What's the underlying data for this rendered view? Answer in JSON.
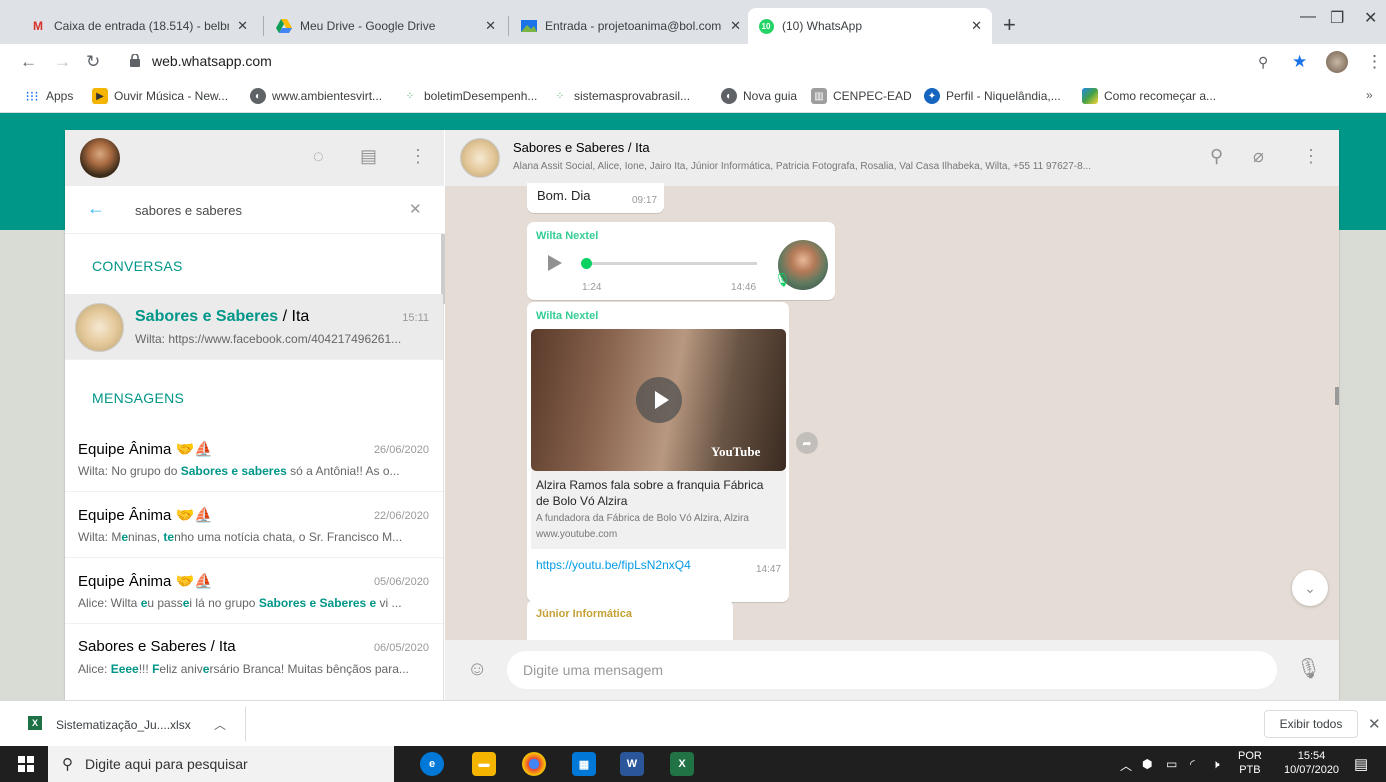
{
  "browser": {
    "tabs": [
      {
        "label": "Caixa de entrada (18.514) - belbr",
        "icon": "gmail-icon"
      },
      {
        "label": "Meu Drive - Google Drive",
        "icon": "drive-icon"
      },
      {
        "label": "Entrada - projetoanima@bol.com",
        "icon": "bol-icon"
      },
      {
        "label": "(10) WhatsApp",
        "icon": "whatsapp-icon",
        "active": true
      }
    ],
    "url": "web.whatsapp.com",
    "bookmarks": [
      {
        "label": "Apps"
      },
      {
        "label": "Ouvir Música - New..."
      },
      {
        "label": "www.ambientesvirt..."
      },
      {
        "label": "boletimDesempenh..."
      },
      {
        "label": "sistemasprovabrasil..."
      },
      {
        "label": "Nova guia"
      },
      {
        "label": "CENPEC-EAD"
      },
      {
        "label": "Perfil - Niquelândia,..."
      },
      {
        "label": "Como recomeçar a..."
      }
    ],
    "bookmarks_more": "»"
  },
  "sidebar": {
    "search_value": "sabores e saberes",
    "section_conversations": "CONVERSAS",
    "section_messages": "MENSAGENS",
    "conversation": {
      "title_bold": "Sabores e Saberes",
      "title_rest": " / Ita",
      "time": "15:11",
      "preview": "Wilta: https://www.facebook.com/404217496261..."
    },
    "messages": [
      {
        "title": "Equipe Ânima",
        "time": "26/06/2020",
        "p1": "Wilta: No grupo do ",
        "h1": "Sabores e saberes",
        "p2": " só a Antônia!! As o..."
      },
      {
        "title": "Equipe Ânima",
        "time": "22/06/2020",
        "p1": "Wilta: M",
        "h1": "e",
        "p2": "ninas, ",
        "h2": "te",
        "p3": "nho uma notícia chata, o Sr. Francisco M..."
      },
      {
        "title": "Equipe Ânima",
        "time": "05/06/2020",
        "p1": "Alice: Wilta ",
        "h1": "e",
        "p2": "u pass",
        "h2": "e",
        "p3": "i lá no grupo ",
        "h3": "Sabores e Saberes e",
        "p4": " vi ..."
      },
      {
        "title": "Sabores e Saberes / Ita",
        "time": "06/05/2020",
        "p1": "Alice: ",
        "h1": "Eeee",
        "p2": "!!! ",
        "h2": "F",
        "p3": "eliz aniv",
        "h3": "e",
        "p4": "rsário Branca! Muitas bênçãos para..."
      }
    ]
  },
  "chat": {
    "group_name": "Sabores e Saberes / Ita",
    "members": "Alana Assit Social, Alice, Ione, Jairo Ita, Júnior Informática, Patricia Fotografa, Rosalia, Val Casa Ilhabeka, Wilta, +55 11 97627-8...",
    "messages": [
      {
        "text": "Bom. Dia",
        "time": "09:17"
      },
      {
        "sender": "Wilta Nextel",
        "audio_duration": "1:24",
        "time": "14:46",
        "audio_progress": 0.0
      },
      {
        "sender": "Wilta Nextel",
        "video_brand": "YouTube",
        "link_title": "Alzira Ramos fala sobre a franquia Fábrica de Bolo Vó Alzira",
        "link_desc": "A fundadora da Fábrica de Bolo Vó Alzira, Alzira",
        "link_domain": "www.youtube.com",
        "link_url": "https://youtu.be/fipLsN2nxQ4",
        "time": "14:47"
      },
      {
        "sender": "Júnior Informática"
      }
    ],
    "input_placeholder": "Digite uma mensagem"
  },
  "downloads": {
    "file": "Sistematização_Ju....xlsx",
    "show_all": "Exibir todos"
  },
  "taskbar": {
    "search_placeholder": "Digite aqui para pesquisar",
    "lang": "POR",
    "lang2": "PTB",
    "time": "15:54",
    "date": "10/07/2020"
  },
  "colors": {
    "accent": "#009688",
    "sender": "#35cd96",
    "chat_bg": "#e5ddd5"
  }
}
